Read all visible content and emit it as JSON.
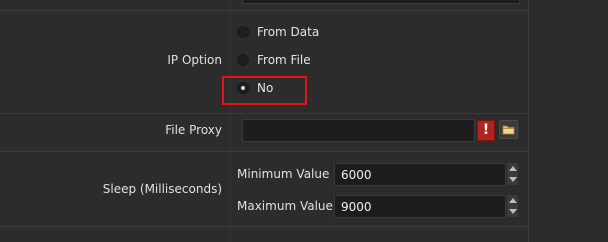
{
  "ip_option": {
    "label": "IP Option",
    "options": [
      {
        "label": "From Data",
        "checked": false
      },
      {
        "label": "From File",
        "checked": false
      },
      {
        "label": "No",
        "checked": true
      }
    ]
  },
  "file_proxy": {
    "label": "File Proxy",
    "value": "",
    "warning_icon": "exclamation-icon",
    "browse_icon": "folder-icon"
  },
  "sleep": {
    "label": "Sleep (Milliseconds)",
    "min_label": "Minimum Value",
    "min_value": "6000",
    "max_label": "Maximum Value",
    "max_value": "9000"
  },
  "colors": {
    "background": "#2c2c2c",
    "field": "#1d1d1d",
    "highlight": "#e0161a",
    "warning": "#b2221f"
  }
}
